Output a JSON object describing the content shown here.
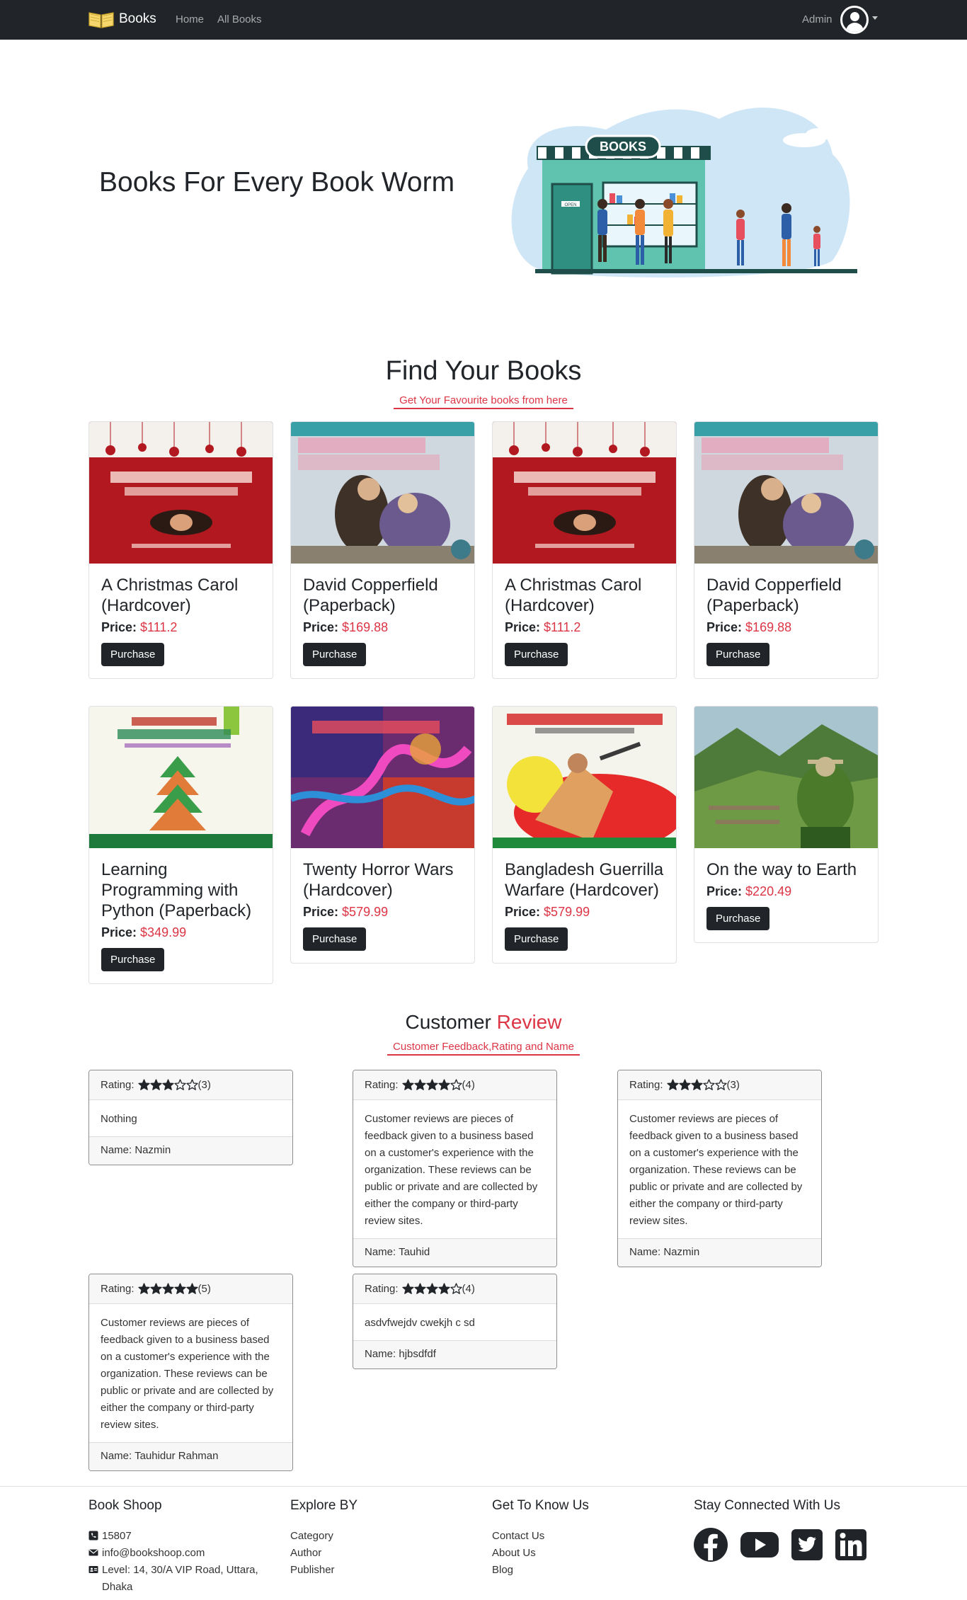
{
  "navbar": {
    "brand": "Books",
    "links": [
      {
        "label": "Home"
      },
      {
        "label": "All Books"
      }
    ],
    "user_label": "Admin"
  },
  "hero": {
    "title": "Books For Every Book Worm",
    "illustration_sign": "BOOKS",
    "illustration_door_sign": "OPEN"
  },
  "books_section": {
    "title": "Find Your Books",
    "subtitle": "Get Your Favourite books from here"
  },
  "books": [
    {
      "title": "A Christmas Carol (Hardcover)",
      "price_label": "Price:",
      "price": "$111.2",
      "button": "Purchase",
      "cover": "christmas-carol"
    },
    {
      "title": "David Copperfield (Paperback)",
      "price_label": "Price:",
      "price": "$169.88",
      "button": "Purchase",
      "cover": "david-copperfield"
    },
    {
      "title": "A Christmas Carol (Hardcover)",
      "price_label": "Price:",
      "price": "$111.2",
      "button": "Purchase",
      "cover": "christmas-carol"
    },
    {
      "title": "David Copperfield (Paperback)",
      "price_label": "Price:",
      "price": "$169.88",
      "button": "Purchase",
      "cover": "david-copperfield"
    },
    {
      "title": "Learning Programming with Python (Paperback)",
      "price_label": "Price:",
      "price": "$349.99",
      "button": "Purchase",
      "cover": "python"
    },
    {
      "title": "Twenty Horror Wars (Hardcover)",
      "price_label": "Price:",
      "price": "$579.99",
      "button": "Purchase",
      "cover": "horror"
    },
    {
      "title": "Bangladesh Guerrilla Warfare (Hardcover)",
      "price_label": "Price:",
      "price": "$579.99",
      "button": "Purchase",
      "cover": "guerrilla"
    },
    {
      "title": "On the way to Earth",
      "price_label": "Price:",
      "price": "$220.49",
      "button": "Purchase",
      "cover": "earth"
    }
  ],
  "reviews_section": {
    "title_part1": "Customer",
    "title_part2": "Review",
    "subtitle": "Customer Feedback,Rating and Name"
  },
  "reviews": [
    {
      "rating_label": "Rating:",
      "stars": 3,
      "rating_text": "(3)",
      "text": "Nothing",
      "name": "Name: Nazmin"
    },
    {
      "rating_label": "Rating:",
      "stars": 4,
      "rating_text": "(4)",
      "text": "Customer reviews are pieces of feedback given to a business based on a customer's experience with the organization. These reviews can be public or private and are collected by either the company or third-party review sites.",
      "name": "Name: Tauhid"
    },
    {
      "rating_label": "Rating:",
      "stars": 3,
      "rating_text": "(3)",
      "text": "Customer reviews are pieces of feedback given to a business based on a customer's experience with the organization. These reviews can be public or private and are collected by either the company or third-party review sites.",
      "name": "Name: Nazmin"
    },
    {
      "rating_label": "Rating:",
      "stars": 5,
      "rating_text": "(5)",
      "text": "Customer reviews are pieces of feedback given to a business based on a customer's experience with the organization. These reviews can be public or private and are collected by either the company or third-party review sites.",
      "name": "Name: Tauhidur Rahman"
    },
    {
      "rating_label": "Rating:",
      "stars": 4,
      "rating_text": "(4)",
      "text": "asdvfwejdv cwekjh c sd",
      "name": "Name: hjbsdfdf"
    }
  ],
  "footer": {
    "col1": {
      "heading": "Book Shoop",
      "phone": "15807",
      "email": "info@bookshoop.com",
      "address": "Level: 14, 30/A VIP Road, Uttara, Dhaka"
    },
    "col2": {
      "heading": "Explore BY",
      "items": [
        "Category",
        "Author",
        "Publisher"
      ]
    },
    "col3": {
      "heading": "Get To Know Us",
      "items": [
        "Contact Us",
        "About Us",
        "Blog"
      ]
    },
    "col4": {
      "heading": "Stay Connected With Us",
      "icons": [
        "facebook-icon",
        "youtube-icon",
        "twitter-icon",
        "linkedin-icon"
      ]
    }
  },
  "colors": {
    "accent": "#dc3545",
    "navbar": "#212529",
    "button": "#212529"
  }
}
